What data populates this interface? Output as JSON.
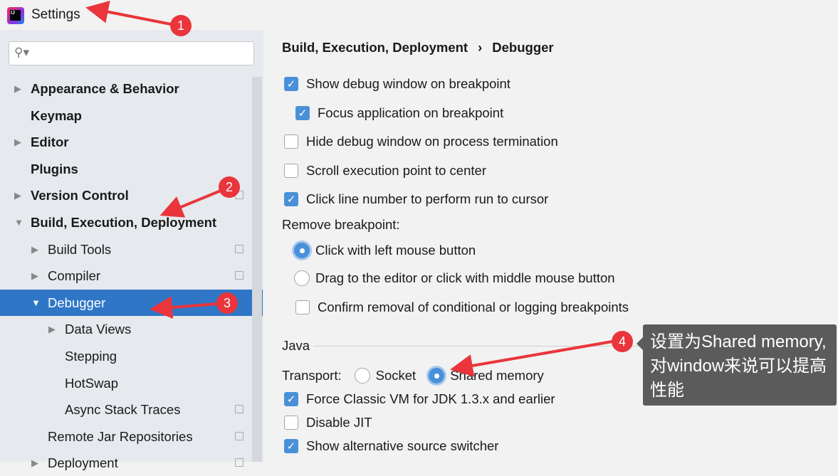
{
  "window": {
    "title": "Settings",
    "logo": "IJ"
  },
  "search": {
    "placeholder": "",
    "icon": "search-icon"
  },
  "sidebar": {
    "items": [
      {
        "label": "Appearance & Behavior",
        "bold": true,
        "arrow": "▶"
      },
      {
        "label": "Keymap",
        "bold": true,
        "arrow": ""
      },
      {
        "label": "Editor",
        "bold": true,
        "arrow": "▶"
      },
      {
        "label": "Plugins",
        "bold": true,
        "arrow": ""
      },
      {
        "label": "Version Control",
        "bold": true,
        "arrow": "▶"
      },
      {
        "label": "Build, Execution, Deployment",
        "bold": true,
        "arrow": "▼"
      },
      {
        "label": "Build Tools",
        "arrow": "▶"
      },
      {
        "label": "Compiler",
        "arrow": "▶"
      },
      {
        "label": "Debugger",
        "arrow": "▼",
        "selected": true
      },
      {
        "label": "Data Views",
        "arrow": "▶"
      },
      {
        "label": "Stepping",
        "arrow": ""
      },
      {
        "label": "HotSwap",
        "arrow": ""
      },
      {
        "label": "Async Stack Traces",
        "arrow": ""
      },
      {
        "label": "Remote Jar Repositories",
        "arrow": ""
      },
      {
        "label": "Deployment",
        "arrow": "▶"
      }
    ]
  },
  "breadcrumb": {
    "parent": "Build, Execution, Deployment",
    "sep": "›",
    "current": "Debugger"
  },
  "options": [
    {
      "label": "Show debug window on breakpoint",
      "checked": true
    },
    {
      "label": "Focus application on breakpoint",
      "checked": true
    },
    {
      "label": "Hide debug window on process termination",
      "checked": false
    },
    {
      "label": "Scroll execution point to center",
      "checked": false
    },
    {
      "label": "Click line number to perform run to cursor",
      "checked": true
    }
  ],
  "remove_breakpoint": {
    "label": "Remove breakpoint:",
    "options": [
      {
        "label": "Click with left mouse button",
        "selected": true
      },
      {
        "label": "Drag to the editor or click with middle mouse button",
        "selected": false
      }
    ],
    "confirm": {
      "label": "Confirm removal of conditional or logging breakpoints",
      "checked": false
    }
  },
  "java": {
    "section": "Java",
    "transport_label": "Transport:",
    "transport": [
      {
        "label": "Socket",
        "selected": false
      },
      {
        "label": "Shared memory",
        "selected": true
      }
    ],
    "options": [
      {
        "label": "Force Classic VM for JDK 1.3.x and earlier",
        "checked": true
      },
      {
        "label": "Disable JIT",
        "checked": false
      },
      {
        "label": "Show alternative source switcher",
        "checked": true
      }
    ]
  },
  "annotations": {
    "badges": [
      "1",
      "2",
      "3",
      "4"
    ],
    "tooltip": "设置为Shared memory,对window来说可以提高性能",
    "color": "#e9353b"
  }
}
